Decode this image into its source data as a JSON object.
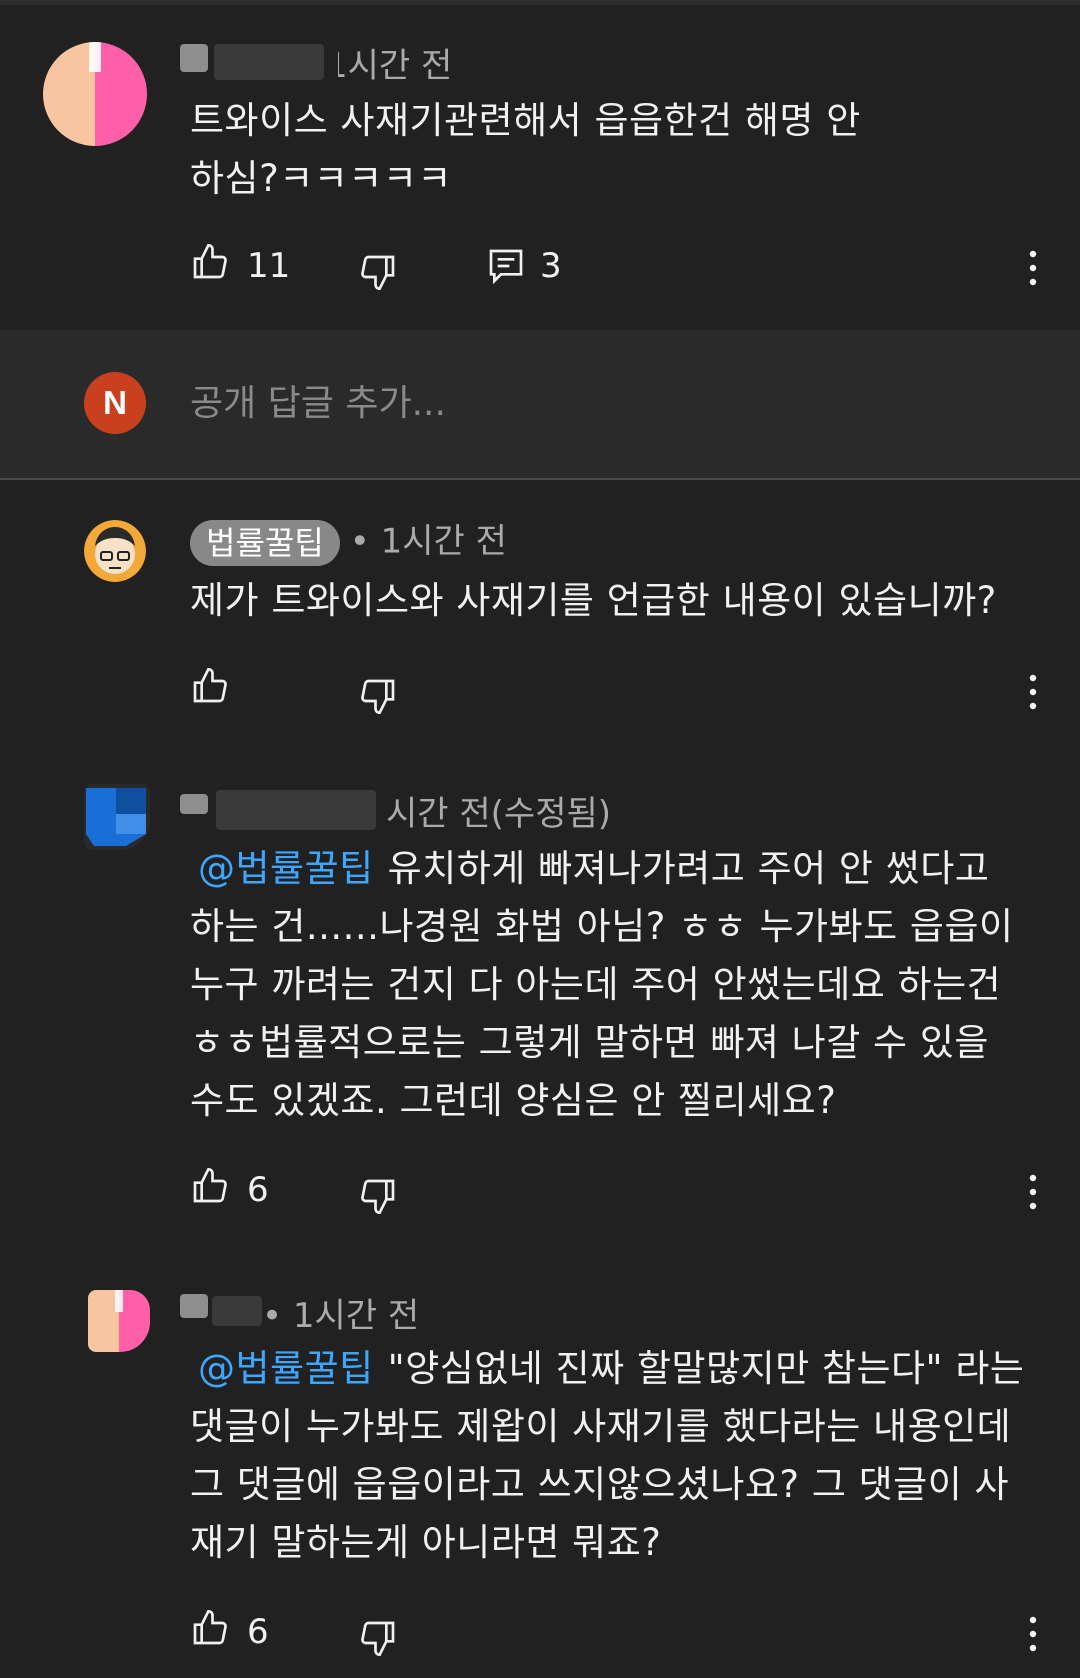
{
  "comments": [
    {
      "time": "1시간 전",
      "text": "트와이스 사재기관련해서 읍읍한건 해명 안 하심?ㅋㅋㅋㅋㅋ",
      "likes": "11",
      "replies": "3",
      "avatar_colors": [
        "#f7c5a0",
        "#ff5fa8"
      ]
    },
    {
      "author": "법률꿀팁",
      "time": "• 1시간 전",
      "text": "제가 트와이스와 사재기를 언급한 내용이 있습니까?"
    },
    {
      "time": "시간 전(수정됨)",
      "mention": "@법률꿀팁",
      "text": "유치하게 빠져나가려고 주어 안 썼다고 하는 건......나경원 화법 아님? ㅎㅎ 누가봐도 읍읍이 누구 까려는 건지 다 아는데 주어 안썼는데요 하는건 ㅎㅎ법률적으로는 그렇게 말하면 빠져 나갈 수 있을 수도 있겠죠. 그런데 양심은 안 찔리세요?",
      "likes": "6",
      "avatar_colors": [
        "#1a6fd6",
        "#3f8fe6"
      ]
    },
    {
      "time": "• 1시간 전",
      "mention": "@법률꿀팁",
      "text": "\"양심없네 진짜 할말많지만 참는다\" 라는 댓글이 누가봐도 제왑이 사재기를 했다라는 내용인데 그 댓글에 읍읍이라고 쓰지않으셨나요? 그 댓글이 사재기 말하는게 아니라면 뭐죠?",
      "likes": "6",
      "avatar_colors": [
        "#f7c5a0",
        "#ff5fa8"
      ]
    }
  ],
  "reply_box": {
    "avatar_letter": "N",
    "placeholder": "공개 답글 추가..."
  },
  "icons": [
    "thumb-up-icon",
    "thumb-down-icon",
    "reply-icon",
    "more-vert-icon"
  ],
  "colors": {
    "background": "#212121",
    "mention": "#3ea6ff",
    "reply_avatar": "#c8401e"
  }
}
